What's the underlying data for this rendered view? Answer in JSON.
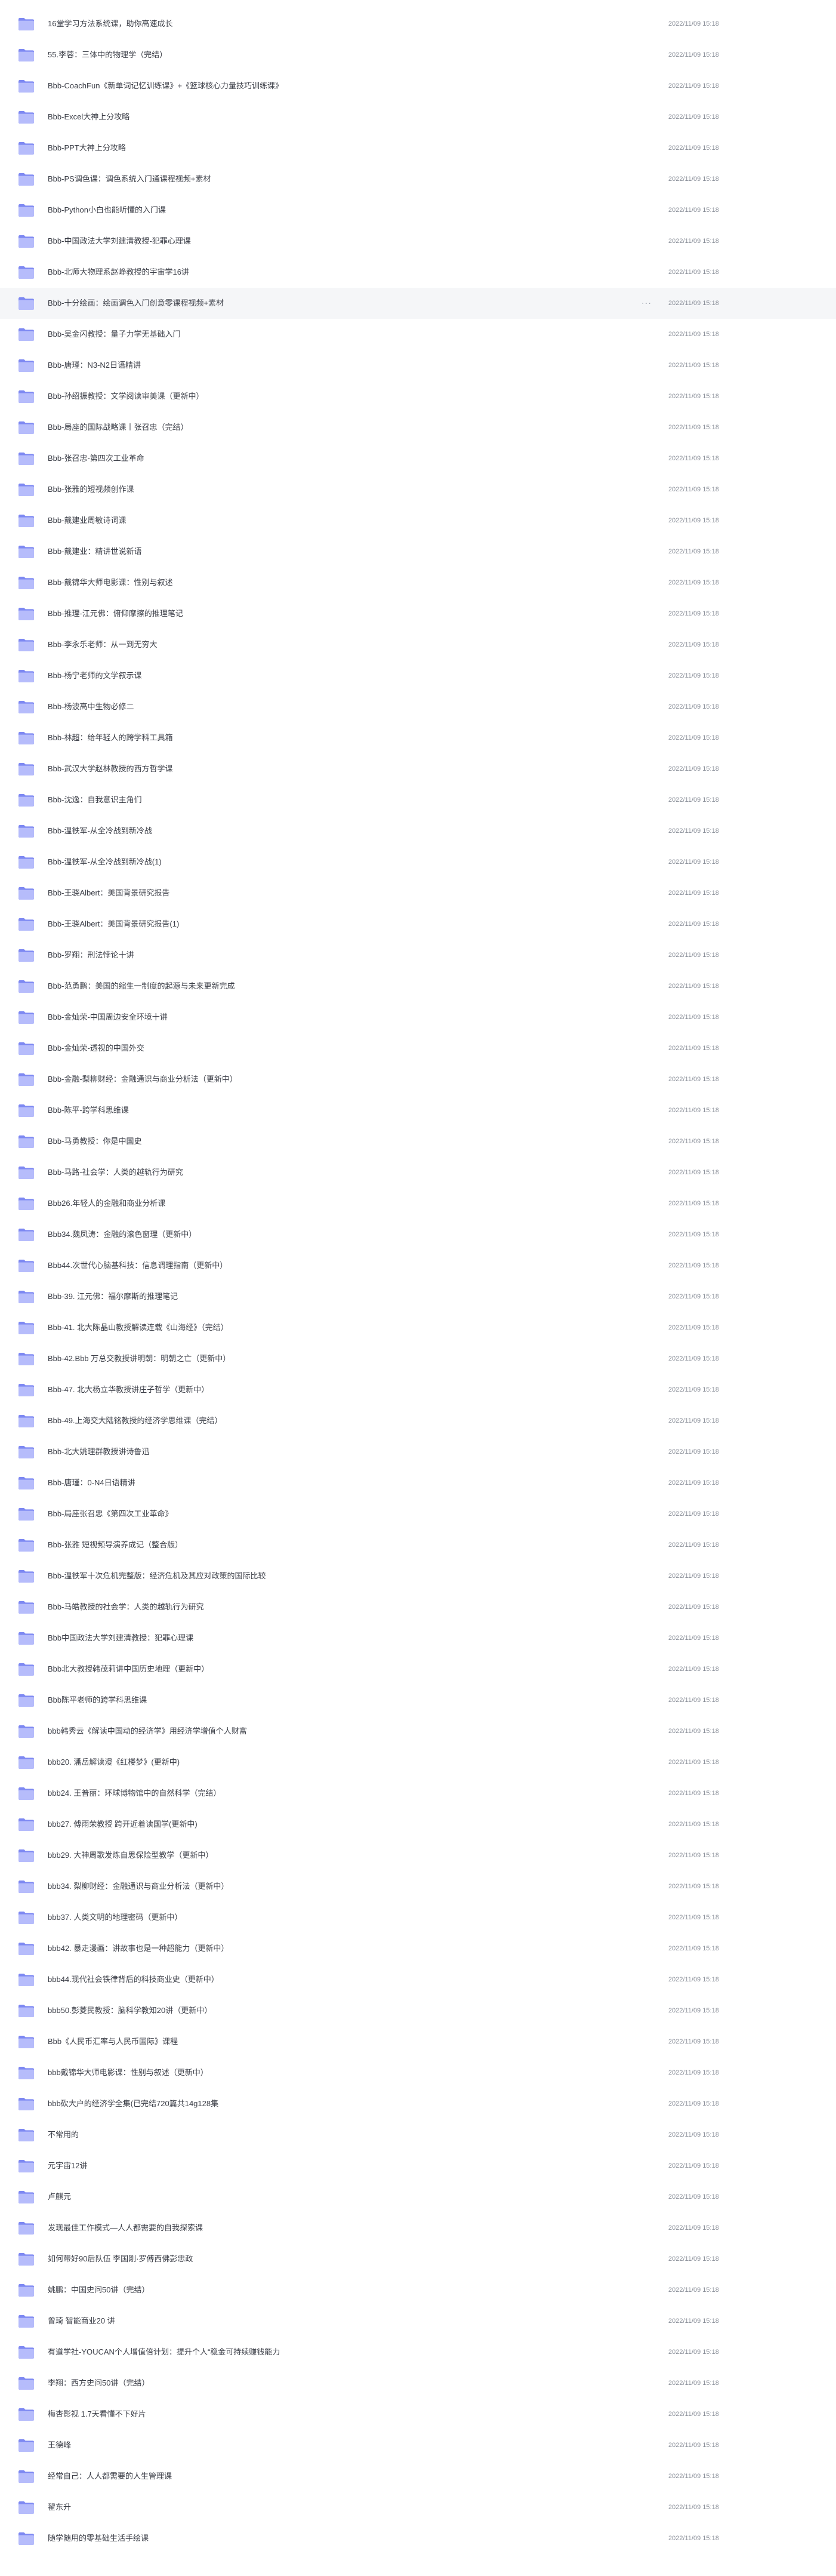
{
  "colors": {
    "folder_back": "#7d88f2",
    "folder_front": "#b6bcfb",
    "row_hover_bg": "#f5f6f8",
    "text": "#3b3e47",
    "time_text": "#8a8f99"
  },
  "icon": "folder-icon",
  "more_label": "···",
  "files": [
    {
      "name": "16堂学习方法系统课，助你高速成长",
      "time": "2022/11/09 15:18"
    },
    {
      "name": "55.李蓉：三体中的物理学（完结）",
      "time": "2022/11/09 15:18"
    },
    {
      "name": "Bbb-CoachFun《新单词记忆训练课》+《篮球核心力量技巧训练课》",
      "time": "2022/11/09 15:18"
    },
    {
      "name": "Bbb-Excel大神上分攻略",
      "time": "2022/11/09 15:18"
    },
    {
      "name": "Bbb-PPT大神上分攻略",
      "time": "2022/11/09 15:18"
    },
    {
      "name": "Bbb-PS调色课：调色系统入门通课程视频+素材",
      "time": "2022/11/09 15:18"
    },
    {
      "name": "Bbb-Python小白也能听懂的入门课",
      "time": "2022/11/09 15:18"
    },
    {
      "name": "Bbb-中国政法大学刘建清教授-犯罪心理课",
      "time": "2022/11/09 15:18"
    },
    {
      "name": "Bbb-北师大物理系赵峥教授的宇宙学16讲",
      "time": "2022/11/09 15:18"
    },
    {
      "name": "Bbb-十分绘画：绘画调色入门创意零课程视频+素材",
      "time": "2022/11/09 15:18",
      "hovered": true
    },
    {
      "name": "Bbb-吴金闪教授：量子力学无基础入门",
      "time": "2022/11/09 15:18"
    },
    {
      "name": "Bbb-唐瑾：N3-N2日语精讲",
      "time": "2022/11/09 15:18"
    },
    {
      "name": "Bbb-孙绍振教授：文学阅读审美课（更新中）",
      "time": "2022/11/09 15:18"
    },
    {
      "name": "Bbb-局座的国际战略课丨张召忠（完结）",
      "time": "2022/11/09 15:18"
    },
    {
      "name": "Bbb-张召忠-第四次工业革命",
      "time": "2022/11/09 15:18"
    },
    {
      "name": "Bbb-张雅的短视频创作课",
      "time": "2022/11/09 15:18"
    },
    {
      "name": "Bbb-戴建业周敏诗词课",
      "time": "2022/11/09 15:18"
    },
    {
      "name": "Bbb-戴建业：精讲世说新语",
      "time": "2022/11/09 15:18"
    },
    {
      "name": "Bbb-戴锦华大师电影课：性别与叙述",
      "time": "2022/11/09 15:18"
    },
    {
      "name": "Bbb-推理-江元佛：俯仰摩擦的推理笔记",
      "time": "2022/11/09 15:18"
    },
    {
      "name": "Bbb-李永乐老师：从一到无穷大",
      "time": "2022/11/09 15:18"
    },
    {
      "name": "Bbb-杨宁老师的文学叙示课",
      "time": "2022/11/09 15:18"
    },
    {
      "name": "Bbb-杨波高中生物必修二",
      "time": "2022/11/09 15:18"
    },
    {
      "name": "Bbb-林超：给年轻人的跨学科工具箱",
      "time": "2022/11/09 15:18"
    },
    {
      "name": "Bbb-武汉大学赵林教授的西方哲学课",
      "time": "2022/11/09 15:18"
    },
    {
      "name": "Bbb-沈逸：自我意识主角们",
      "time": "2022/11/09 15:18"
    },
    {
      "name": "Bbb-温铁军-从全冷战到新冷战",
      "time": "2022/11/09 15:18"
    },
    {
      "name": "Bbb-温铁军-从全冷战到新冷战(1)",
      "time": "2022/11/09 15:18"
    },
    {
      "name": "Bbb-王骁Albert：美国背景研究报告",
      "time": "2022/11/09 15:18"
    },
    {
      "name": "Bbb-王骁Albert：美国背景研究报告(1)",
      "time": "2022/11/09 15:18"
    },
    {
      "name": "Bbb-罗翔：刑法悖论十讲",
      "time": "2022/11/09 15:18"
    },
    {
      "name": "Bbb-范勇鹏：美国的缩生一制度的起源与未来更新完成",
      "time": "2022/11/09 15:18"
    },
    {
      "name": "Bbb-金灿荣-中国周边安全环境十讲",
      "time": "2022/11/09 15:18"
    },
    {
      "name": "Bbb-金灿荣-透视的中国外交",
      "time": "2022/11/09 15:18"
    },
    {
      "name": "Bbb-金融-梨柳财经：金融通识与商业分析法（更新中）",
      "time": "2022/11/09 15:18"
    },
    {
      "name": "Bbb-陈平-跨学科思维课",
      "time": "2022/11/09 15:18"
    },
    {
      "name": "Bbb-马勇教授：你是中国史",
      "time": "2022/11/09 15:18"
    },
    {
      "name": "Bbb-马路-社会学：人类的越轨行为研究",
      "time": "2022/11/09 15:18"
    },
    {
      "name": "Bbb26.年轻人的金融和商业分析课",
      "time": "2022/11/09 15:18"
    },
    {
      "name": "Bbb34.魏凤涛：金融的滚色窗理（更新中）",
      "time": "2022/11/09 15:18"
    },
    {
      "name": "Bbb44.次世代心脑基科技：信息调理指南（更新中）",
      "time": "2022/11/09 15:18"
    },
    {
      "name": "Bbb-39. 江元佛：福尔摩斯的推理笔记",
      "time": "2022/11/09 15:18"
    },
    {
      "name": "Bbb-41. 北大陈晶山教授解读连载《山海经》（完结）",
      "time": "2022/11/09 15:18"
    },
    {
      "name": "Bbb-42.Bbb 万总交教授讲明朝：明朝之亡（更新中）",
      "time": "2022/11/09 15:18"
    },
    {
      "name": "Bbb-47. 北大杨立华教授讲庄子哲学（更新中）",
      "time": "2022/11/09 15:18"
    },
    {
      "name": "Bbb-49.上海交大陆铭教授的经济学思维课（完结）",
      "time": "2022/11/09 15:18"
    },
    {
      "name": "Bbb-北大姚理群教授讲诗鲁迅",
      "time": "2022/11/09 15:18"
    },
    {
      "name": "Bbb-唐瑾：0-N4日语精讲",
      "time": "2022/11/09 15:18"
    },
    {
      "name": "Bbb-局座张召忠《第四次工业革命》",
      "time": "2022/11/09 15:18"
    },
    {
      "name": "Bbb-张雅 短视频导演养成记（整合版）",
      "time": "2022/11/09 15:18"
    },
    {
      "name": "Bbb-温铁军十次危机完整版：经济危机及其应对政策的国际比较",
      "time": "2022/11/09 15:18"
    },
    {
      "name": "Bbb-马皓教授的社会学：人类的越轨行为研究",
      "time": "2022/11/09 15:18"
    },
    {
      "name": "Bbb中国政法大学刘建清教授：犯罪心理课",
      "time": "2022/11/09 15:18"
    },
    {
      "name": "Bbb北大教授韩茂莉讲中国历史地理（更新中）",
      "time": "2022/11/09 15:18"
    },
    {
      "name": "Bbb陈平老师的跨学科思维课",
      "time": "2022/11/09 15:18"
    },
    {
      "name": "bbb韩秀云《解读中国动的经济学》用经济学增值个人财富",
      "time": "2022/11/09 15:18"
    },
    {
      "name": "bbb20. 潘岳解读漫《红楼梦》(更新中)",
      "time": "2022/11/09 15:18"
    },
    {
      "name": "bbb24. 王普丽：环球博物馆中的自然科学（完结）",
      "time": "2022/11/09 15:18"
    },
    {
      "name": "bbb27. 傅雨荣教授 跨开近着读国学(更新中)",
      "time": "2022/11/09 15:18"
    },
    {
      "name": "bbb29. 大神周歌发炼自思保险型教学（更新中）",
      "time": "2022/11/09 15:18"
    },
    {
      "name": "bbb34. 梨柳财经：金融通识与商业分析法（更新中）",
      "time": "2022/11/09 15:18"
    },
    {
      "name": "bbb37. 人类文明的地理密码（更新中）",
      "time": "2022/11/09 15:18"
    },
    {
      "name": "bbb42. 暴走漫画：讲故事也是一种超能力（更新中）",
      "time": "2022/11/09 15:18"
    },
    {
      "name": "bbb44.现代社会铁律背后的科技商业史（更新中）",
      "time": "2022/11/09 15:18"
    },
    {
      "name": "bbb50.彭菱民教授：脑科学教知20讲（更新中）",
      "time": "2022/11/09 15:18"
    },
    {
      "name": "Bbb《人民币汇率与人民币国际》课程",
      "time": "2022/11/09 15:18"
    },
    {
      "name": "bbb戴锦华大师电影课：性别与叙述（更新中）",
      "time": "2022/11/09 15:18"
    },
    {
      "name": "bbb砍大户的经济学全集(已完结720篇共14g128集",
      "time": "2022/11/09 15:18"
    },
    {
      "name": "不常用的",
      "time": "2022/11/09 15:18"
    },
    {
      "name": "元宇宙12讲",
      "time": "2022/11/09 15:18"
    },
    {
      "name": "卢麒元",
      "time": "2022/11/09 15:18"
    },
    {
      "name": "发现最佳工作模式—人人都需要的自我探索课",
      "time": "2022/11/09 15:18"
    },
    {
      "name": "如何带好90后队伍 李国刚·罗傅西佛彭忠政",
      "time": "2022/11/09 15:18"
    },
    {
      "name": "姚鹏：中国史问50讲（完结）",
      "time": "2022/11/09 15:18"
    },
    {
      "name": "曾琦 智能商业20 讲",
      "time": "2022/11/09 15:18"
    },
    {
      "name": "有道学社-YOUCAN个人增值倍计划：提升个人“稳金可持续赚钱能力",
      "time": "2022/11/09 15:18"
    },
    {
      "name": "李翔：西方史问50讲（完结）",
      "time": "2022/11/09 15:18"
    },
    {
      "name": "梅杏影视 1.7天看懂不下好片",
      "time": "2022/11/09 15:18"
    },
    {
      "name": "王德峰",
      "time": "2022/11/09 15:18"
    },
    {
      "name": "经常自己：人人都需要的人生管理课",
      "time": "2022/11/09 15:18"
    },
    {
      "name": "翟东升",
      "time": "2022/11/09 15:18"
    },
    {
      "name": "随学随用的零基础生活手绘课",
      "time": "2022/11/09 15:18"
    }
  ]
}
